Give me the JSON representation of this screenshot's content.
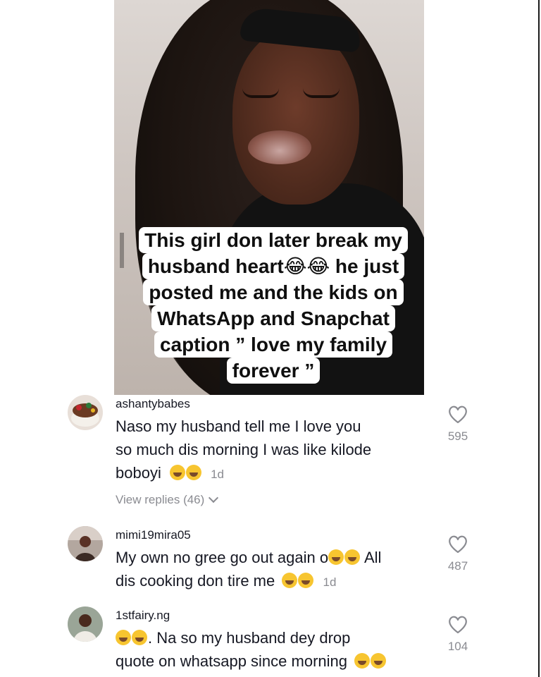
{
  "video": {
    "caption_lines": [
      "This girl don later break my",
      "husband heart😂😂 he just",
      "posted me and the kids on",
      "WhatsApp and Snapchat",
      "caption ” love my family",
      "forever ”"
    ]
  },
  "comments": [
    {
      "username": "ashantybabes",
      "text_lines": [
        "Naso my husband tell me I love you",
        "so much dis morning I was like kilode",
        "boboyi"
      ],
      "time": "1d",
      "likes": "595",
      "view_replies": "View replies (46)",
      "avatar_icon": "avatar-cake-icon"
    },
    {
      "username": "mimi19mira05",
      "text_lines": [
        "My own no gree go out again o",
        " All",
        "dis cooking don tire me"
      ],
      "time": "1d",
      "likes": "487",
      "avatar_icon": "avatar-person-icon"
    },
    {
      "username": "1stfairy.ng",
      "text_lines": [
        ". Na so my husband dey drop",
        "quote on whatsapp since morning"
      ],
      "likes": "104",
      "avatar_icon": "avatar-person-icon"
    }
  ],
  "colors": {
    "text": "#161823",
    "secondary": "#8a8b91",
    "emoji": "#f7c530"
  }
}
